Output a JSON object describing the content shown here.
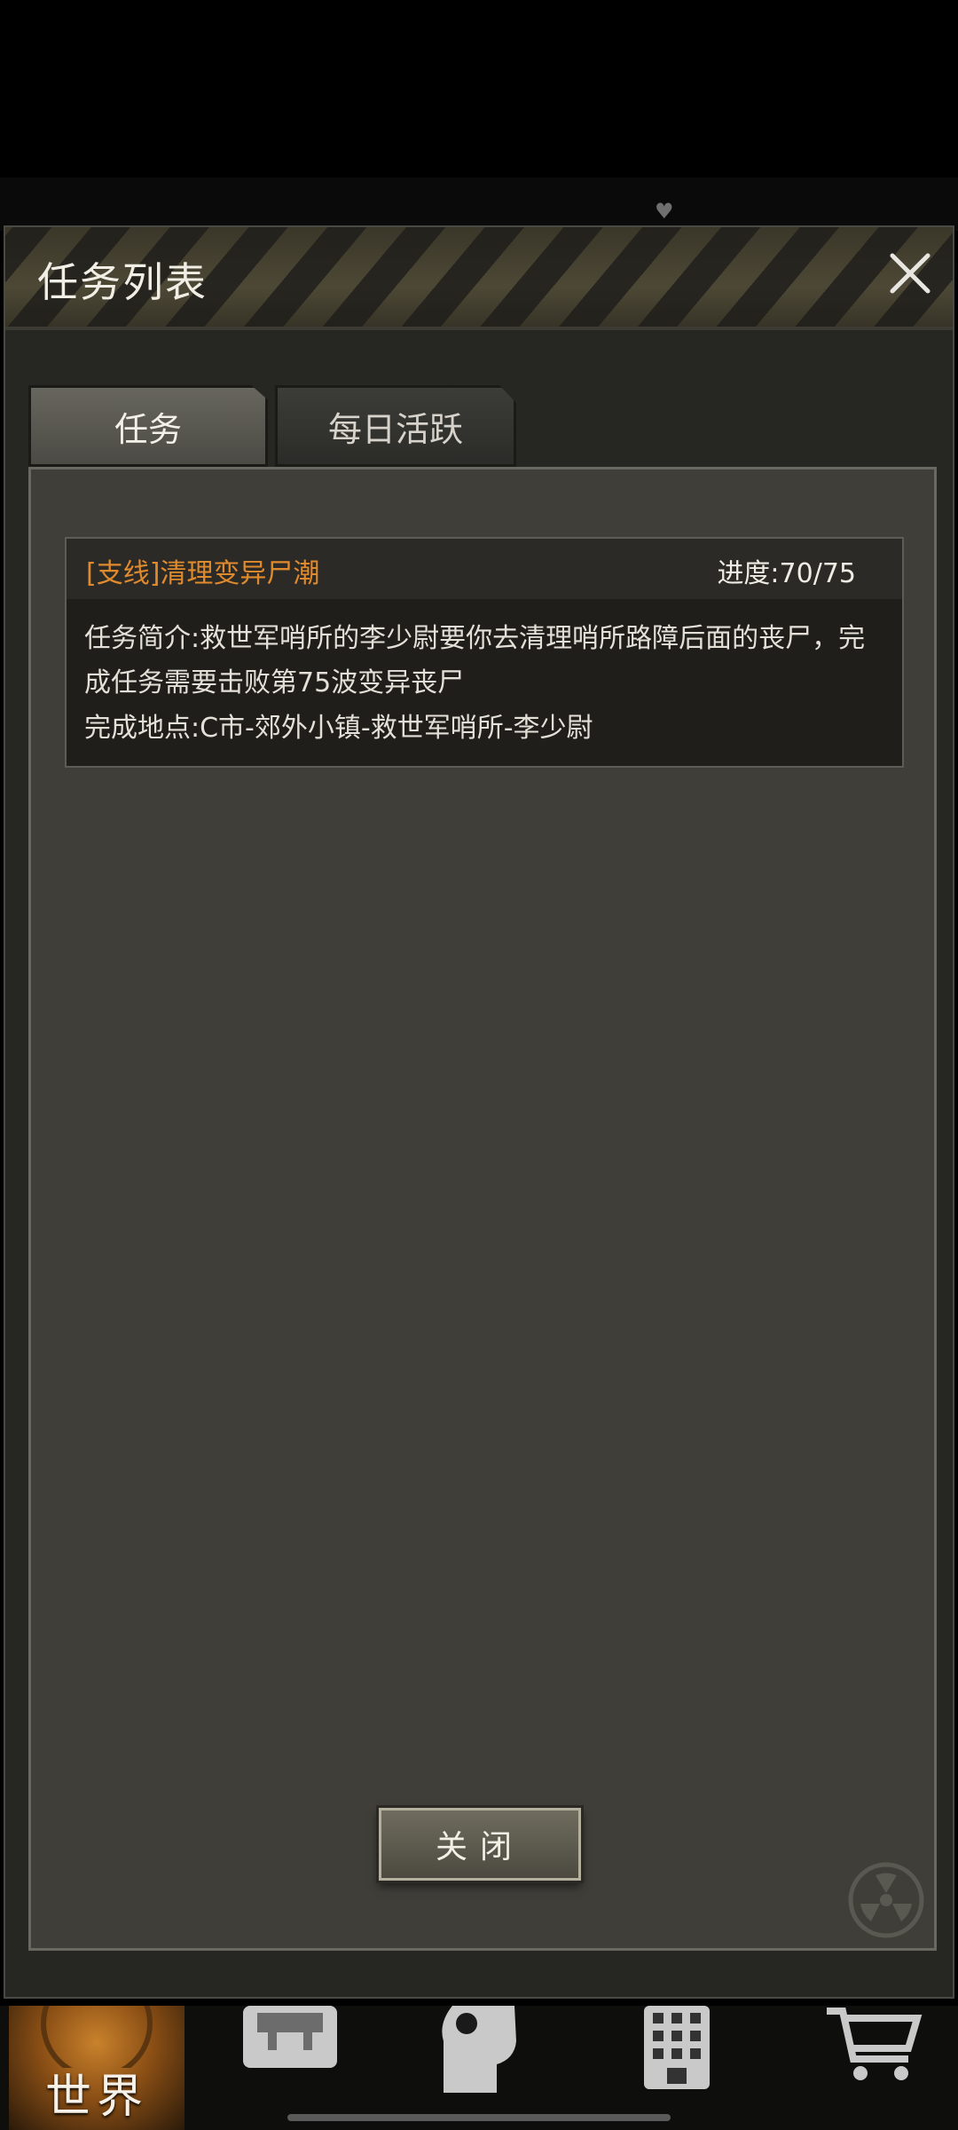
{
  "dialog": {
    "title": "任务列表",
    "tabs": [
      {
        "label": "任务",
        "active": true
      },
      {
        "label": "每日活跃",
        "active": false
      }
    ],
    "quest": {
      "name": "[支线]清理变异尸潮",
      "progress_label": "进度:70/75",
      "progress": {
        "current": 70,
        "total": 75
      },
      "description_line1": "任务简介:救世军哨所的李少尉要你去清理哨所路障后面的丧尸，完",
      "description_line2": "成任务需要击败第75波变异丧尸",
      "location": "完成地点:C市-郊外小镇-救世军哨所-李少尉"
    },
    "close_button": "关闭"
  },
  "bottom_nav": {
    "world_label": "世界",
    "items": [
      "world-icon",
      "backpack-icon",
      "head-profile-icon",
      "building-icon",
      "shopping-cart-icon"
    ]
  },
  "colors": {
    "quest_name": "#e08a2e",
    "panel_bg": "#3f3e39",
    "dialog_bg": "#262622"
  }
}
